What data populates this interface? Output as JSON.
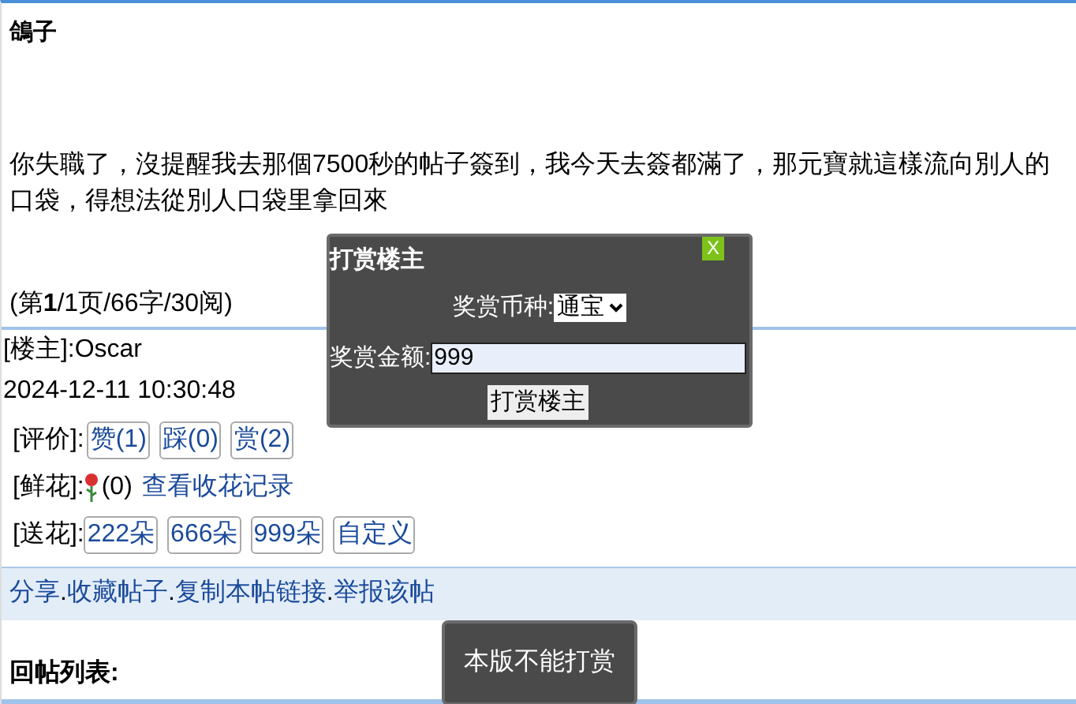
{
  "post": {
    "title": "鴿子",
    "body": "你失職了，沒提醒我去那個7500秒的帖子簽到，我今天去簽都滿了，那元寶就這樣流向別人的口袋，得想法從別人口袋里拿回來",
    "stats": "(第**1**/1页/66字/30阅)"
  },
  "author": {
    "label": "[楼主]:Oscar",
    "time": "2024-12-11 10:30:48"
  },
  "ratings": {
    "label": "[评价]:",
    "buttons": [
      "赞(1)",
      "踩(0)",
      "赏(2)"
    ]
  },
  "flowers": {
    "label": "[鲜花]:",
    "count": "(0)",
    "link": "查看收花记录"
  },
  "give_flowers": {
    "label": "[送花]:",
    "buttons": [
      "222朵",
      "666朵",
      "999朵",
      "自定义"
    ]
  },
  "actions": [
    "分享",
    "收藏帖子",
    "复制本帖链接",
    "举报该帖"
  ],
  "action_separator": ".",
  "replies_heading": "回帖列表:",
  "reward_dialog": {
    "title": "打赏楼主",
    "close": "X",
    "currency_label": "奖赏币种:",
    "currency": "通宝",
    "amount_label": "奖赏金额:",
    "amount": "999",
    "submit": "打赏楼主"
  },
  "toast": "本版不能打赏"
}
